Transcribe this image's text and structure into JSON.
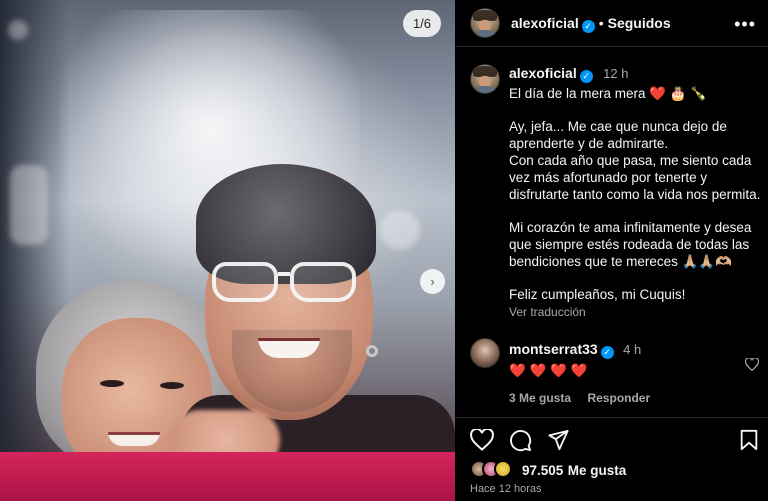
{
  "photo": {
    "counter": "1/6",
    "next_icon": "chevron-right-icon"
  },
  "header": {
    "username": "alexoficial",
    "verified_icon": "verified-badge-icon",
    "separator": "•",
    "follow_status": "Seguidos",
    "more_icon": "more-horizontal-icon"
  },
  "caption": {
    "username": "alexoficial",
    "time": "12 h",
    "line1": "El día de la mera mera ❤️ 🎂 🍾",
    "para1": [
      "Ay, jefa... Me cae que nunca dejo de",
      "aprenderte y de admirarte.",
      "Con cada año que pasa, me siento cada",
      "vez más afortunado por tenerte y",
      "disfrutarte tanto como la vida nos permita."
    ],
    "para2": [
      "Mi corazón te ama infinitamente y desea",
      "que siempre estés rodeada de todas las",
      "bendiciones que te mereces 🙏🏼🙏🏼🫶🏼"
    ],
    "closing": "Feliz cumpleaños, mi Cuquis!",
    "translate": "Ver traducción"
  },
  "comment": {
    "username": "montserrat33",
    "time": "4 h",
    "text": "❤️ ❤️ ❤️ ❤️",
    "likes": "3 Me gusta",
    "reply": "Responder",
    "heart_icon": "heart-outline-icon"
  },
  "actions": {
    "like_icon": "heart-icon",
    "comment_icon": "comment-icon",
    "share_icon": "share-icon",
    "save_icon": "bookmark-icon"
  },
  "likes": {
    "count": "97.505",
    "suffix": "Me gusta",
    "time_ago": "Hace 12 horas"
  }
}
